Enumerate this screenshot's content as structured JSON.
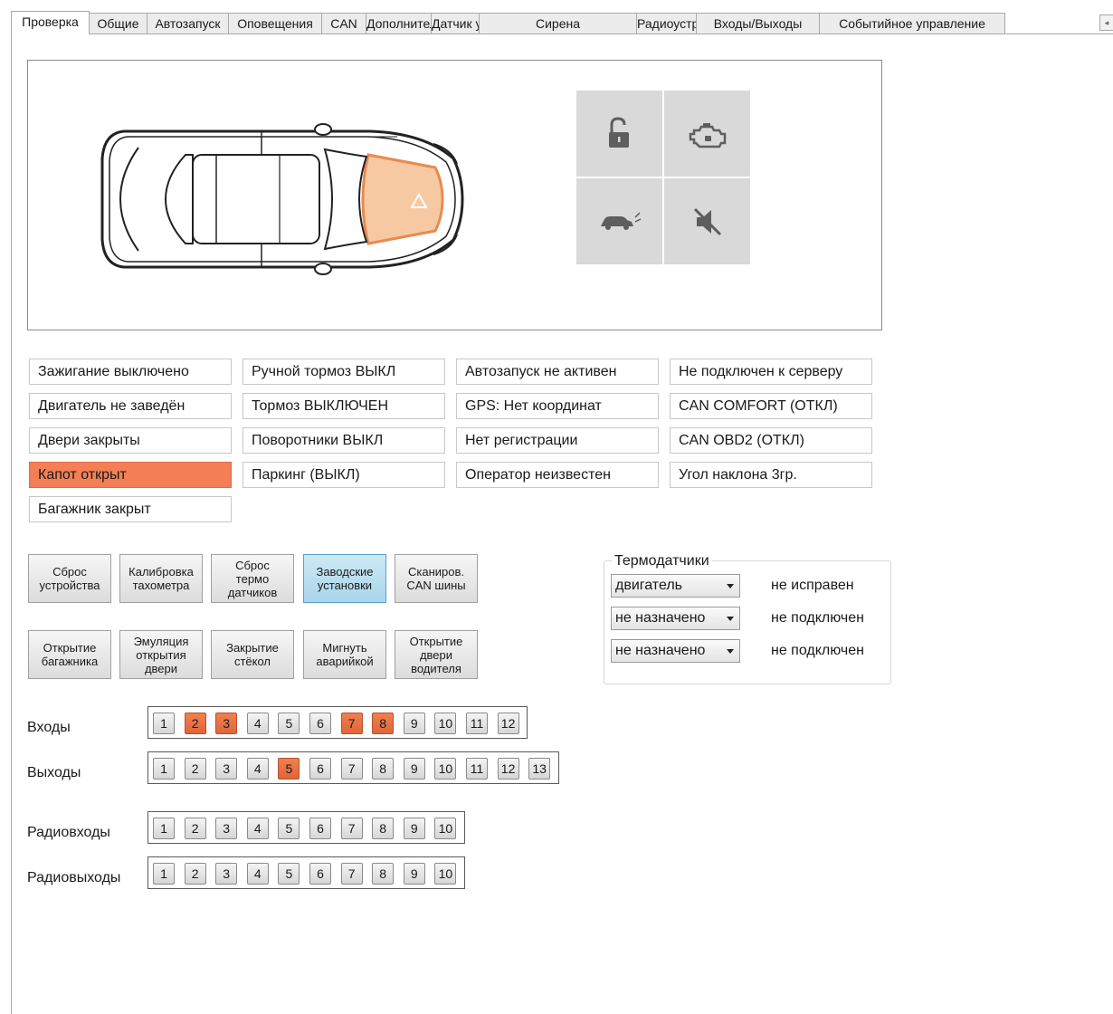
{
  "tabs": [
    {
      "label": "Проверка",
      "active": true
    },
    {
      "label": "Общие",
      "active": false
    },
    {
      "label": "Автозапуск",
      "active": false
    },
    {
      "label": "Оповещения",
      "active": false
    },
    {
      "label": "CAN",
      "active": false
    },
    {
      "label": "Дополнительно",
      "active": false
    },
    {
      "label": "Датчик удара / наклона",
      "active": false
    },
    {
      "label": "Сирена",
      "active": false
    },
    {
      "label": "Радиоустройства",
      "active": false
    },
    {
      "label": "Входы/Выходы",
      "active": false
    },
    {
      "label": "Событийное управление",
      "active": false
    }
  ],
  "tab_scroll_icon": "arrow-left-icon",
  "car_panel": {
    "alert_zone": "hood",
    "alert_color": "#f7c9a2",
    "alert_icon": "warning-triangle-icon",
    "icons": [
      "lock-open-icon",
      "engine-icon",
      "car-signal-icon",
      "mute-icon"
    ]
  },
  "status": {
    "col1": [
      {
        "text": "Зажигание выключено",
        "alert": false
      },
      {
        "text": "Двигатель не заведён",
        "alert": false
      },
      {
        "text": "Двери закрыты",
        "alert": false
      },
      {
        "text": "Капот открыт",
        "alert": true
      },
      {
        "text": "Багажник закрыт",
        "alert": false
      }
    ],
    "col2": [
      {
        "text": "Ручной тормоз ВЫКЛ",
        "alert": false
      },
      {
        "text": "Тормоз ВЫКЛЮЧЕН",
        "alert": false
      },
      {
        "text": "Поворотники ВЫКЛ",
        "alert": false
      },
      {
        "text": "Паркинг (ВЫКЛ)",
        "alert": false
      }
    ],
    "col3": [
      {
        "text": "Автозапуск не активен",
        "alert": false
      },
      {
        "text": "GPS: Нет координат",
        "alert": false
      },
      {
        "text": "Нет регистрации",
        "alert": false
      },
      {
        "text": "Оператор неизвестен",
        "alert": false
      }
    ],
    "col4": [
      {
        "text": "Не подключен к серверу",
        "alert": false
      },
      {
        "text": "CAN COMFORT (ОТКЛ)",
        "alert": false
      },
      {
        "text": "CAN OBD2 (ОТКЛ)",
        "alert": false
      },
      {
        "text": "Угол наклона 3гр.",
        "alert": false
      }
    ],
    "alert_color": "#f47f57"
  },
  "commands": {
    "row1": [
      {
        "label": "Сброс\nустройства",
        "highlight": false
      },
      {
        "label": "Калибровка\nтахометра",
        "highlight": false
      },
      {
        "label": "Сброс\nтермо\nдатчиков",
        "highlight": false
      },
      {
        "label": "Заводские\nустановки",
        "highlight": true
      },
      {
        "label": "Сканиров.\nCAN шины",
        "highlight": false
      }
    ],
    "row2": [
      {
        "label": "Открытие\nбагажника",
        "highlight": false
      },
      {
        "label": "Эмуляция\nоткрытия\nдвери",
        "highlight": false
      },
      {
        "label": "Закрытие\nстёкол",
        "highlight": false
      },
      {
        "label": "Мигнуть\nаварийкой",
        "highlight": false
      },
      {
        "label": "Открытие\nдвери\nводителя",
        "highlight": false
      }
    ]
  },
  "thermo": {
    "title": "Термодатчики",
    "rows": [
      {
        "select": "двигатель",
        "status": "не исправен"
      },
      {
        "select": "не назначено",
        "status": "не подключен"
      },
      {
        "select": "не назначено",
        "status": "не подключен"
      }
    ]
  },
  "io": {
    "inputs": {
      "label": "Входы",
      "count": 12,
      "active": [
        2,
        3,
        7,
        8
      ]
    },
    "outputs": {
      "label": "Выходы",
      "count": 13,
      "active": [
        5
      ]
    },
    "radio_inputs": {
      "label": "Радиовходы",
      "count": 10,
      "active": []
    },
    "radio_outputs": {
      "label": "Радиовыходы",
      "count": 10,
      "active": []
    },
    "active_color": "#e8693f"
  }
}
